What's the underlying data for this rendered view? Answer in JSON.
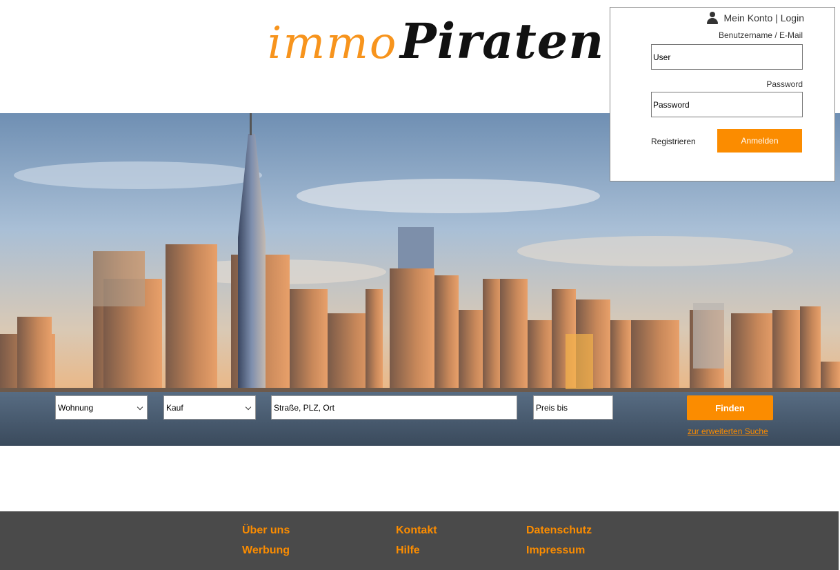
{
  "logo": {
    "part1": "immo",
    "part2": "Piraten"
  },
  "login": {
    "header": "Mein Konto | Login",
    "username_label": "Benutzername / E-Mail",
    "username_placeholder": "User",
    "password_label": "Password",
    "password_placeholder": "Password",
    "register_label": "Registrieren",
    "submit_label": "Anmelden"
  },
  "search": {
    "type_value": "Wohnung",
    "mode_value": "Kauf",
    "location_placeholder": "Straße, PLZ, Ort",
    "price_placeholder": "Preis bis",
    "find_label": "Finden",
    "advanced_link": "zur erweiterten Suche"
  },
  "footer": {
    "links": [
      "Über uns",
      "Werbung",
      "Kontakt",
      "Hilfe",
      "Datenschutz",
      "Impressum"
    ]
  },
  "colors": {
    "accent": "#fb8c00",
    "footer_bg": "#4a4a4a"
  },
  "icons": {
    "account": "user-icon",
    "dropdown": "chevron-down-icon"
  }
}
